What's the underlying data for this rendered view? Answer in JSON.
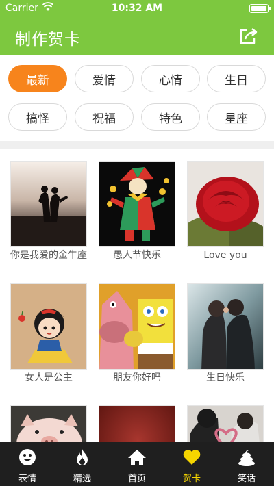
{
  "status_bar": {
    "carrier": "Carrier",
    "time": "10:32 AM"
  },
  "header": {
    "title": "制作贺卡"
  },
  "categories": [
    {
      "label": "最新",
      "active": true
    },
    {
      "label": "爱情",
      "active": false
    },
    {
      "label": "心情",
      "active": false
    },
    {
      "label": "生日",
      "active": false
    },
    {
      "label": "搞怪",
      "active": false
    },
    {
      "label": "祝福",
      "active": false
    },
    {
      "label": "特色",
      "active": false
    },
    {
      "label": "星座",
      "active": false
    }
  ],
  "cards": [
    {
      "caption": "你是我爱的金牛座"
    },
    {
      "caption": "愚人节快乐"
    },
    {
      "caption": "Love you"
    },
    {
      "caption": "女人是公主"
    },
    {
      "caption": "朋友你好吗"
    },
    {
      "caption": "生日快乐"
    },
    {
      "caption": ""
    },
    {
      "caption": ""
    },
    {
      "caption": ""
    }
  ],
  "tab_bar": [
    {
      "label": "表情",
      "icon": "smiley-icon",
      "active": false
    },
    {
      "label": "精选",
      "icon": "flame-icon",
      "active": false
    },
    {
      "label": "首页",
      "icon": "home-icon",
      "active": false
    },
    {
      "label": "贺卡",
      "icon": "heart-icon",
      "active": true
    },
    {
      "label": "笑话",
      "icon": "poop-icon",
      "active": false
    }
  ],
  "colors": {
    "primary": "#7dc83f",
    "accent": "#f7841c",
    "tab_bar": "#1f1f1f",
    "tab_active": "#f5d500"
  }
}
